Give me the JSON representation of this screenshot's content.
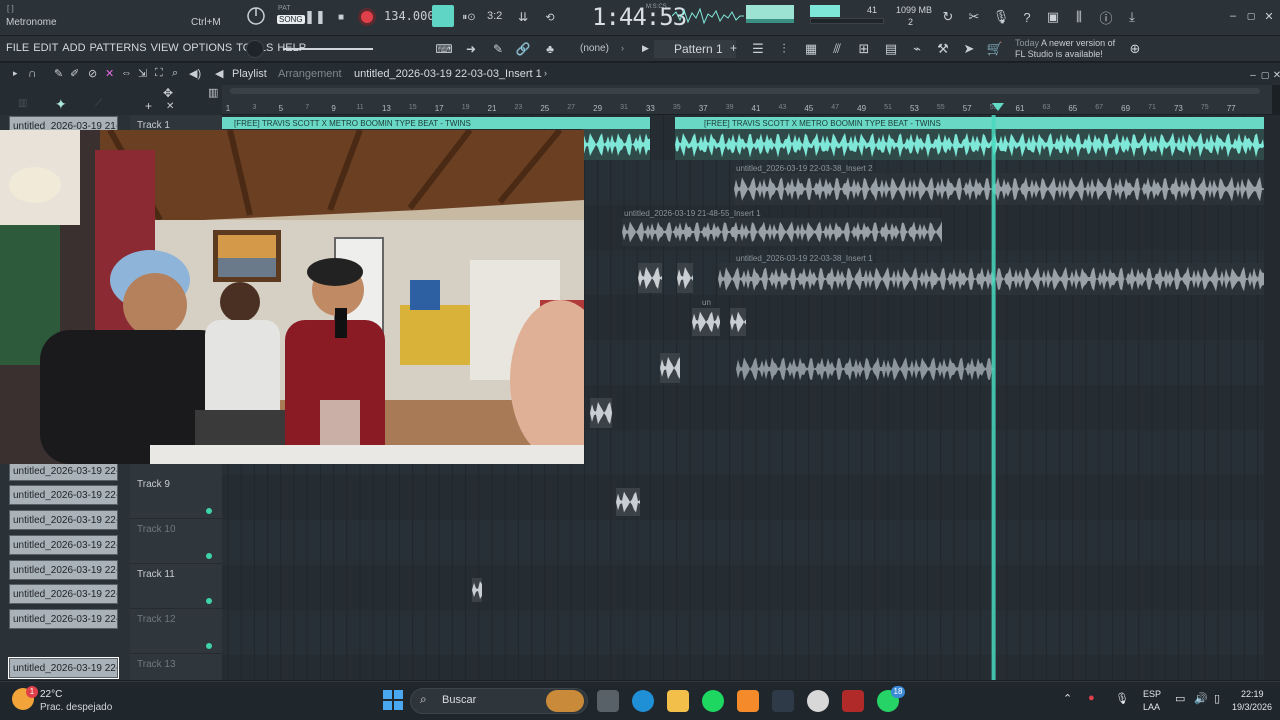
{
  "transport": {
    "metronome_label": "Metronome",
    "shortcut_label": "Ctrl+M",
    "pat_label": "PAT",
    "song_label": "SONG",
    "tempo": "134.000",
    "step": "3:2",
    "time": "1:44:53",
    "time_unit": "M:S:CS",
    "cpu_value": "41",
    "ram_value": "1099 MB",
    "poly_value": "2"
  },
  "menu": {
    "items": [
      "FILE",
      "EDIT",
      "ADD",
      "PATTERNS",
      "VIEW",
      "OPTIONS",
      "TOOLS",
      "HELP"
    ],
    "none_label": "(none)",
    "pattern_label": "Pattern 1",
    "news_today": "Today",
    "news_text": "A newer version of FL Studio is available!"
  },
  "playlist": {
    "title": "Playlist",
    "subtitle": "Arrangement",
    "file": "untitled_2026-03-19 22-03-03_Insert 1",
    "ruler_numbers": [
      1,
      3,
      5,
      7,
      9,
      11,
      13,
      15,
      17,
      19,
      21,
      23,
      25,
      27,
      29,
      31,
      33,
      35,
      37,
      39,
      41,
      43,
      45,
      47,
      49,
      51,
      53,
      55,
      57,
      59,
      61,
      63,
      65,
      67,
      69,
      71,
      73,
      75,
      77
    ],
    "playhead_bar": 59,
    "tracks": [
      {
        "name": "Track 1",
        "dim": false
      },
      {
        "name": "Track 9",
        "dim": false
      },
      {
        "name": "Track 10",
        "dim": true
      },
      {
        "name": "Track 11",
        "dim": false
      },
      {
        "name": "Track 12",
        "dim": true
      },
      {
        "name": "Track 13",
        "dim": true
      }
    ],
    "clips": {
      "beat_left": "[FREE] TRAVIS SCOTT X METRO BOOMIN TYPE BEAT - TWINS",
      "beat_right": "[FREE] TRAVIS SCOTT X METRO BOOMIN TYPE BEAT - TWINS",
      "insert2": "untitled_2026-03-19 22-03-38_Insert 2",
      "insert1_a": "untitled_2026-03-19 21-48-55_Insert 1",
      "insert1_b": "untitled_2026-03-19 22-03-38_Insert 1",
      "small_un": "un"
    }
  },
  "picker": {
    "top_item": "untitled_2026-03-19 21-...",
    "items": [
      "untitled_2026-03-19 22-...",
      "untitled_2026-03-19 22-...",
      "untitled_2026-03-19 22-...",
      "untitled_2026-03-19 22-...",
      "untitled_2026-03-19 22-...",
      "untitled_2026-03-19 22-...",
      "untitled_2026-03-19 22-...",
      "untitled_2026-03-19 22-..."
    ]
  },
  "taskbar": {
    "weather_temp": "22°C",
    "weather_desc": "Prac. despejado",
    "weather_badge": "1",
    "search_label": "Buscar",
    "whatsapp_badge": "18",
    "lang_top": "ESP",
    "lang_bottom": "LAA",
    "clock_time": "22:19",
    "clock_date": "19/3/2026"
  },
  "colors": {
    "accent": "#7fe7d7",
    "record": "#e0404a",
    "playhead": "#49d9c0"
  }
}
